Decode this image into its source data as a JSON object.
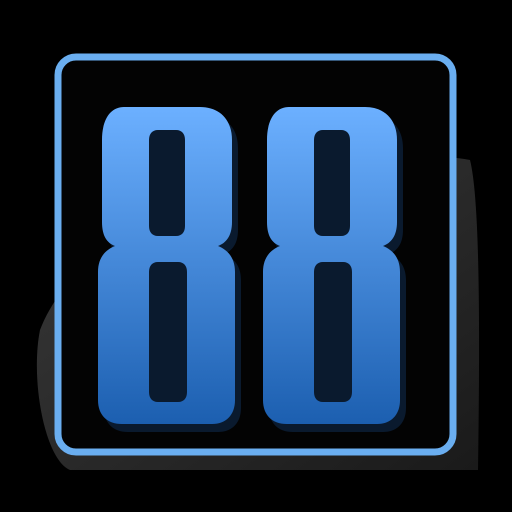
{
  "logo": {
    "text": "88",
    "icon": "number-88-logo-icon"
  },
  "colors": {
    "background": "#000000",
    "frame_fill": "#030303",
    "frame_stroke": "#6aaef0",
    "digit_light": "#6cb0ff",
    "digit_dark": "#1c5fb0",
    "shadow_blob": "#2b2b2b"
  }
}
